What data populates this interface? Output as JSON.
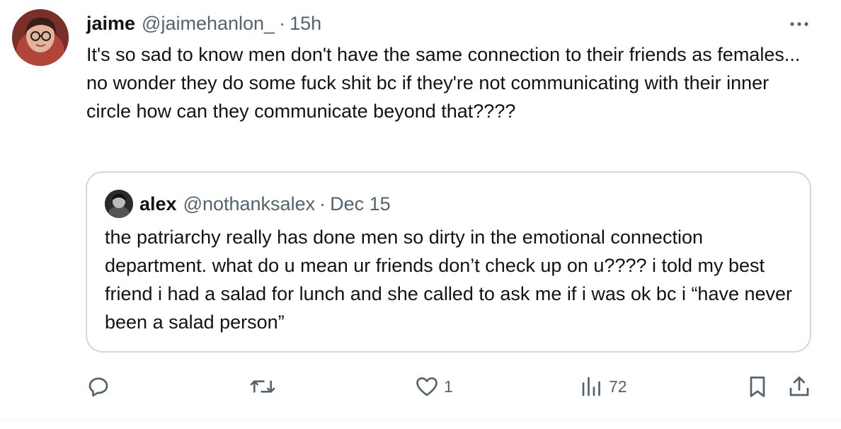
{
  "tweet": {
    "author_name": "jaime",
    "author_handle": "@jaimehanlon_",
    "separator": "·",
    "time": "15h",
    "text": "It's so sad to know men don't have the same connection to their friends as females... no wonder they do some fuck shit bc if they're not communicating with their inner circle how can they communicate beyond that????",
    "avatar_icon": "profile-photo"
  },
  "quote": {
    "author_name": "alex",
    "author_handle": "@nothanksalex",
    "separator": "·",
    "date": "Dec 15",
    "text": "the patriarchy really has done men so dirty in the emotional connection department. what do u mean ur friends don’t check up on u???? i told my best friend i had a salad for lunch and she called to ask me if i was ok bc i “have never been a salad person”",
    "avatar_icon": "profile-photo"
  },
  "actions": {
    "reply": {
      "icon": "reply-icon",
      "count": ""
    },
    "retweet": {
      "icon": "retweet-icon",
      "count": ""
    },
    "like": {
      "icon": "heart-icon",
      "count": "1"
    },
    "views": {
      "icon": "views-icon",
      "count": "72"
    },
    "bookmark": {
      "icon": "bookmark-icon"
    },
    "share": {
      "icon": "share-icon"
    }
  },
  "colors": {
    "text": "#0f1419",
    "muted": "#536471",
    "border": "#cfd9de"
  }
}
